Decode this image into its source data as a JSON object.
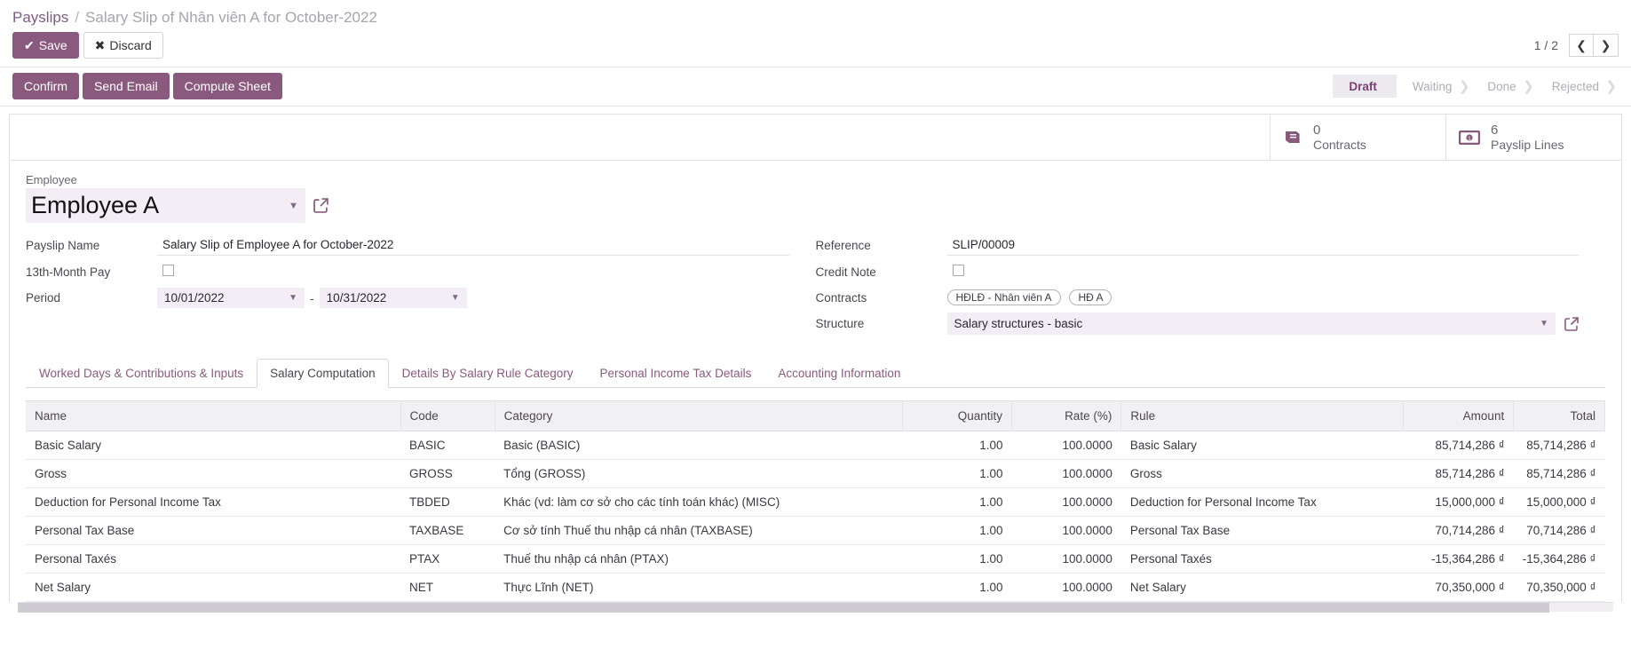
{
  "breadcrumb": {
    "root": "Payslips",
    "separator": "/",
    "current": "Salary Slip of Nhân viên A for October-2022"
  },
  "actions": {
    "save_label": "Save",
    "save_icon": "check-icon",
    "discard_label": "Discard",
    "discard_icon": "times-icon"
  },
  "pager": {
    "count": "1 / 2",
    "prev_icon": "chevron-left-icon",
    "next_icon": "chevron-right-icon"
  },
  "workflow": {
    "buttons": [
      {
        "label": "Confirm",
        "name": "confirm-button"
      },
      {
        "label": "Send Email",
        "name": "send-email-button"
      },
      {
        "label": "Compute Sheet",
        "name": "compute-sheet-button"
      }
    ],
    "statuses": [
      {
        "label": "Draft",
        "active": true
      },
      {
        "label": "Waiting",
        "active": false
      },
      {
        "label": "Done",
        "active": false
      },
      {
        "label": "Rejected",
        "active": false
      }
    ]
  },
  "stat_buttons": [
    {
      "value": "0",
      "label": "Contracts",
      "icon": "book-icon"
    },
    {
      "value": "6",
      "label": "Payslip Lines",
      "icon": "money-bill-icon"
    }
  ],
  "employee": {
    "label": "Employee",
    "value": "Employee A",
    "caret_icon": "caret-down-icon",
    "external_icon": "external-link-icon"
  },
  "form_left": {
    "payslip_name": {
      "label": "Payslip Name",
      "value": "Salary Slip of Employee A for October-2022"
    },
    "thirteenth_month_pay": {
      "label": "13th-Month Pay",
      "checked": false
    },
    "period": {
      "label": "Period",
      "date_from": "10/01/2022",
      "date_to": "10/31/2022",
      "separator": "-"
    }
  },
  "form_right": {
    "reference": {
      "label": "Reference",
      "value": "SLIP/00009"
    },
    "credit_note": {
      "label": "Credit Note",
      "checked": false
    },
    "contracts": {
      "label": "Contracts",
      "tags": [
        "HĐLĐ - Nhân viên A",
        "HĐ A"
      ]
    },
    "structure": {
      "label": "Structure",
      "value": "Salary structures - basic",
      "caret_icon": "caret-down-icon",
      "external_icon": "external-link-icon"
    }
  },
  "tabs": [
    {
      "label": "Worked Days & Contributions & Inputs",
      "active": false
    },
    {
      "label": "Salary Computation",
      "active": true
    },
    {
      "label": "Details By Salary Rule Category",
      "active": false
    },
    {
      "label": "Personal Income Tax Details",
      "active": false
    },
    {
      "label": "Accounting Information",
      "active": false
    }
  ],
  "table": {
    "columns": [
      "Name",
      "Code",
      "Category",
      "Quantity",
      "Rate (%)",
      "Rule",
      "Amount",
      "Total"
    ],
    "rows": [
      {
        "name": "Basic Salary",
        "code": "BASIC",
        "category": "Basic (BASIC)",
        "quantity": "1.00",
        "rate": "100.0000",
        "rule": "Basic Salary",
        "amount": "85,714,286 ₫",
        "total": "85,714,286 ₫"
      },
      {
        "name": "Gross",
        "code": "GROSS",
        "category": "Tổng (GROSS)",
        "quantity": "1.00",
        "rate": "100.0000",
        "rule": "Gross",
        "amount": "85,714,286 ₫",
        "total": "85,714,286 ₫"
      },
      {
        "name": "Deduction for Personal Income Tax",
        "code": "TBDED",
        "category": "Khác (vd: làm cơ sở cho các tính toán khác) (MISC)",
        "quantity": "1.00",
        "rate": "100.0000",
        "rule": "Deduction for Personal Income Tax",
        "amount": "15,000,000 ₫",
        "total": "15,000,000 ₫"
      },
      {
        "name": "Personal Tax Base",
        "code": "TAXBASE",
        "category": "Cơ sở tính Thuế thu nhập cá nhân (TAXBASE)",
        "quantity": "1.00",
        "rate": "100.0000",
        "rule": "Personal Tax Base",
        "amount": "70,714,286 ₫",
        "total": "70,714,286 ₫"
      },
      {
        "name": "Personal Taxés",
        "code": "PTAX",
        "category": "Thuế thu nhập cá nhân (PTAX)",
        "quantity": "1.00",
        "rate": "100.0000",
        "rule": "Personal Taxés",
        "amount": "-15,364,286 ₫",
        "total": "-15,364,286 ₫"
      },
      {
        "name": "Net Salary",
        "code": "NET",
        "category": "Thực Lĩnh (NET)",
        "quantity": "1.00",
        "rate": "100.0000",
        "rule": "Net Salary",
        "amount": "70,350,000 ₫",
        "total": "70,350,000 ₫"
      }
    ]
  },
  "colors": {
    "accent": "#8a5a7e",
    "link": "#7c5c85",
    "field_bg": "#f3edf5"
  }
}
